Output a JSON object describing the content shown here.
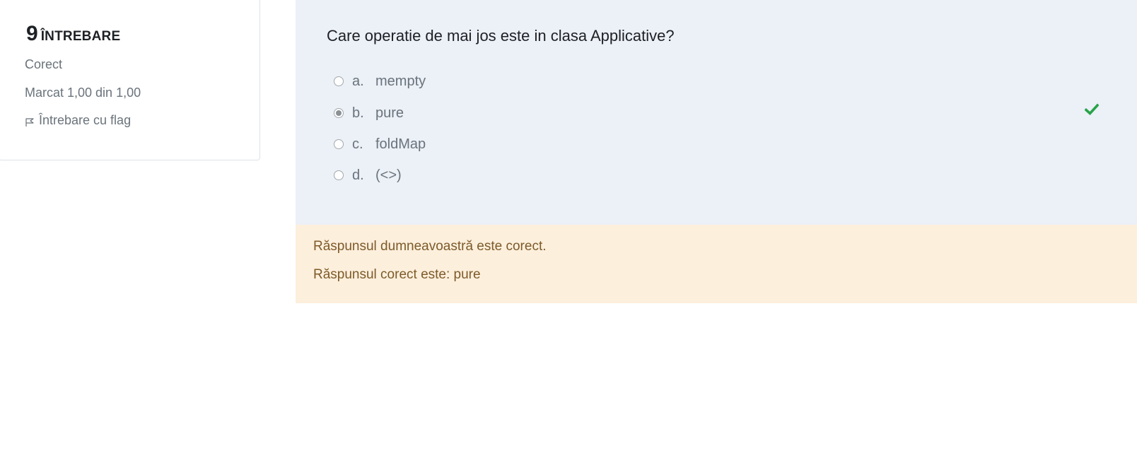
{
  "info": {
    "number": "9",
    "label": "ÎNTREBARE",
    "state": "Corect",
    "grade": "Marcat 1,00 din 1,00",
    "flag_label": "Întrebare cu flag"
  },
  "question": {
    "text": "Care operatie de mai jos este in clasa Applicative?",
    "answers": [
      {
        "letter": "a.",
        "text": "mempty",
        "selected": false
      },
      {
        "letter": "b.",
        "text": "pure",
        "selected": true
      },
      {
        "letter": "c.",
        "text": "foldMap",
        "selected": false
      },
      {
        "letter": "d.",
        "text": "(<>)",
        "selected": false
      }
    ],
    "correct_icon": "check-icon",
    "correct_color": "#27a348"
  },
  "feedback": {
    "general": "Răspunsul dumneavoastră este corect.",
    "right_answer": "Răspunsul corect este: pure"
  },
  "colors": {
    "question_bg": "#ecf0f7",
    "feedback_bg": "#fcefdc",
    "feedback_text": "#7d5a29"
  }
}
